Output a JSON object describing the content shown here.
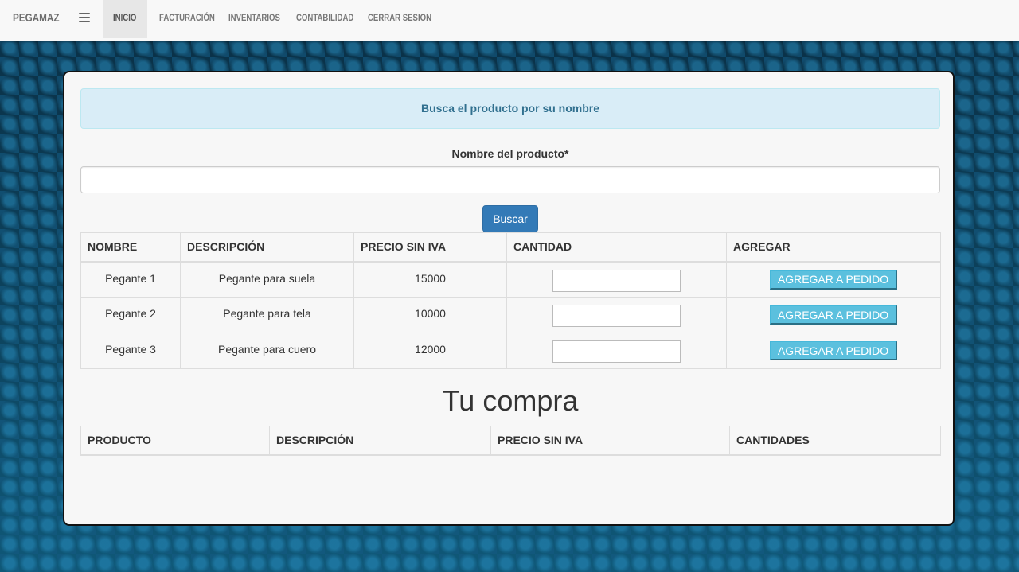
{
  "navbar": {
    "brand": "PEGAMAZ",
    "menu_icon": "hamburger-menu-icon",
    "items": [
      {
        "label": "INICIO",
        "active": true
      },
      {
        "label": "FACTURACIÓN",
        "active": false
      },
      {
        "label": "INVENTARIOS",
        "active": false
      },
      {
        "label": "CONTABILIDAD",
        "active": false
      },
      {
        "label": "CERRAR SESION",
        "active": false
      }
    ]
  },
  "search": {
    "alert": "Busca el producto por su nombre",
    "field_label": "Nombre del producto*",
    "value": "",
    "button_label": "Buscar"
  },
  "products_table": {
    "headers": [
      "NOMBRE",
      "DESCRIPCIÓN",
      "PRECIO SIN IVA",
      "CANTIDAD",
      "AGREGAR"
    ],
    "rows": [
      {
        "nombre": "Pegante 1",
        "descripcion": "Pegante para suela",
        "precio": "15000",
        "cantidad": "",
        "button_label": "AGREGAR A PEDIDO"
      },
      {
        "nombre": "Pegante 2",
        "descripcion": "Pegante para tela",
        "precio": "10000",
        "cantidad": "",
        "button_label": "AGREGAR A PEDIDO"
      },
      {
        "nombre": "Pegante 3",
        "descripcion": "Pegante para cuero",
        "precio": "12000",
        "cantidad": "",
        "button_label": "AGREGAR A PEDIDO"
      }
    ]
  },
  "purchase": {
    "title": "Tu compra",
    "headers": [
      "PRODUCTO",
      "DESCRIPCIÓN",
      "PRECIO SIN IVA",
      "CANTIDADES"
    ]
  },
  "colors": {
    "primary_button": "#337ab7",
    "info_button": "#5bc0de",
    "alert_bg": "#d9edf7",
    "alert_text": "#31708f"
  }
}
